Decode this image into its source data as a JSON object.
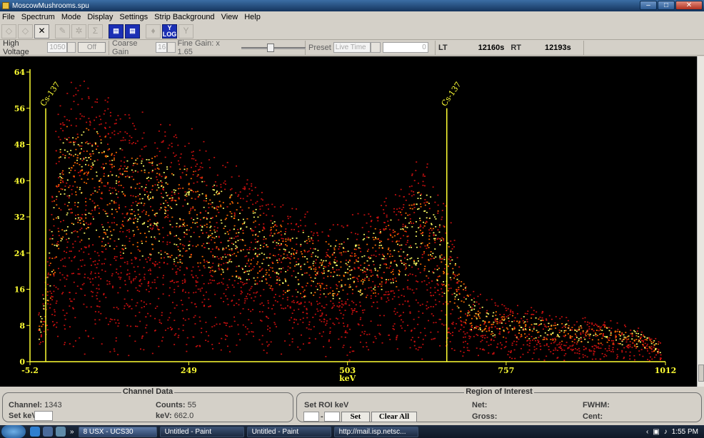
{
  "window": {
    "title": "MoscowMushrooms.spu",
    "controls": [
      "–",
      "□",
      "✕"
    ]
  },
  "menu": [
    "File",
    "Spectrum",
    "Mode",
    "Display",
    "Settings",
    "Strip Background",
    "View",
    "Help"
  ],
  "toolbar": {
    "buttons": [
      {
        "icon": "diamond-icon",
        "glyph": "◇",
        "enabled": false
      },
      {
        "icon": "diamond-outline-icon",
        "glyph": "◇",
        "enabled": false
      },
      {
        "icon": "close-x-icon",
        "glyph": "✕",
        "enabled": true
      },
      {
        "icon": "marker-icon",
        "glyph": "✎",
        "enabled": false
      },
      {
        "icon": "gear-icon",
        "glyph": "✲",
        "enabled": false
      },
      {
        "icon": "sigma-icon",
        "glyph": "Σ",
        "enabled": false
      },
      {
        "icon": "page-a-icon",
        "glyph": "▤",
        "enabled": true,
        "style": "blue"
      },
      {
        "icon": "page-b-icon",
        "glyph": "▤",
        "enabled": true,
        "style": "blue"
      },
      {
        "icon": "bell-icon",
        "glyph": "♦",
        "enabled": false
      },
      {
        "icon": "y-log-icon",
        "glyph": "Y\nLOG",
        "enabled": true,
        "style": "blue"
      },
      {
        "icon": "y-lin-icon",
        "glyph": "Y",
        "enabled": false
      }
    ]
  },
  "controls": {
    "high_voltage_label": "High Voltage",
    "high_voltage_value": "1050",
    "off_button": "Off",
    "coarse_gain_label": "Coarse Gain",
    "coarse_gain_value": "16",
    "fine_gain_label": "Fine Gain: x 1.65",
    "fine_gain_fraction": 0.45,
    "preset_label": "Preset",
    "preset_mode": "Live Time",
    "preset_value": "0",
    "lt_label": "LT",
    "lt_value": "12160s",
    "rt_label": "RT",
    "rt_value": "12193s"
  },
  "chart_data": {
    "type": "scatter",
    "xlabel": "keV",
    "x_ticks": [
      "-5.2",
      "249",
      "503",
      "757",
      "1012"
    ],
    "x_tick_values": [
      -5.2,
      249,
      503,
      757,
      1012
    ],
    "xlim": [
      -5.2,
      1012
    ],
    "y_ticks": [
      0,
      8,
      16,
      24,
      32,
      40,
      48,
      56,
      64
    ],
    "ylim": [
      0,
      64
    ],
    "colors": {
      "axis": "#ffff33",
      "dots_low": "#cc1010",
      "dots_mid": "#ff6a00",
      "dots_high": "#ffff66"
    },
    "envelope_x": [
      5,
      20,
      40,
      60,
      80,
      100,
      130,
      170,
      210,
      250,
      290,
      330,
      370,
      410,
      450,
      490,
      520,
      550,
      580,
      600,
      620,
      640,
      660,
      680,
      700,
      730,
      760,
      800,
      850,
      900,
      960,
      1010
    ],
    "envelope_y": [
      8,
      20,
      55,
      60,
      59,
      57,
      54,
      52,
      50,
      48,
      44,
      40,
      36,
      33,
      31,
      30,
      31,
      33,
      36,
      40,
      44,
      40,
      32,
      22,
      16,
      13,
      12,
      11,
      10,
      9,
      8,
      4
    ],
    "markers": [
      {
        "label": "Cs-137",
        "x": 20,
        "y_top": 56
      },
      {
        "label": "Cs-137",
        "x": 662,
        "y_top": 56
      }
    ]
  },
  "channel_data": {
    "title": "Channel Data",
    "channel_label": "Channel:",
    "channel_value": "1343",
    "counts_label": "Counts:",
    "counts_value": "55",
    "setkev_label": "Set keV",
    "kev_label": "keV:",
    "kev_value": "662.0"
  },
  "roi": {
    "title": "Region of Interest",
    "set_roi_label": "Set ROI keV",
    "dash": "-",
    "set_button": "Set",
    "clear_button": "Clear All",
    "net_label": "Net:",
    "gross_label": "Gross:",
    "fwhm_label": "FWHM:",
    "cent_label": "Cent:"
  },
  "taskbar": {
    "tasks": [
      "8 USX - UCS30",
      "Untitled - Paint",
      "Untitled - Paint",
      "http://mail.isp.netsc..."
    ],
    "clock": "1:55 PM"
  }
}
